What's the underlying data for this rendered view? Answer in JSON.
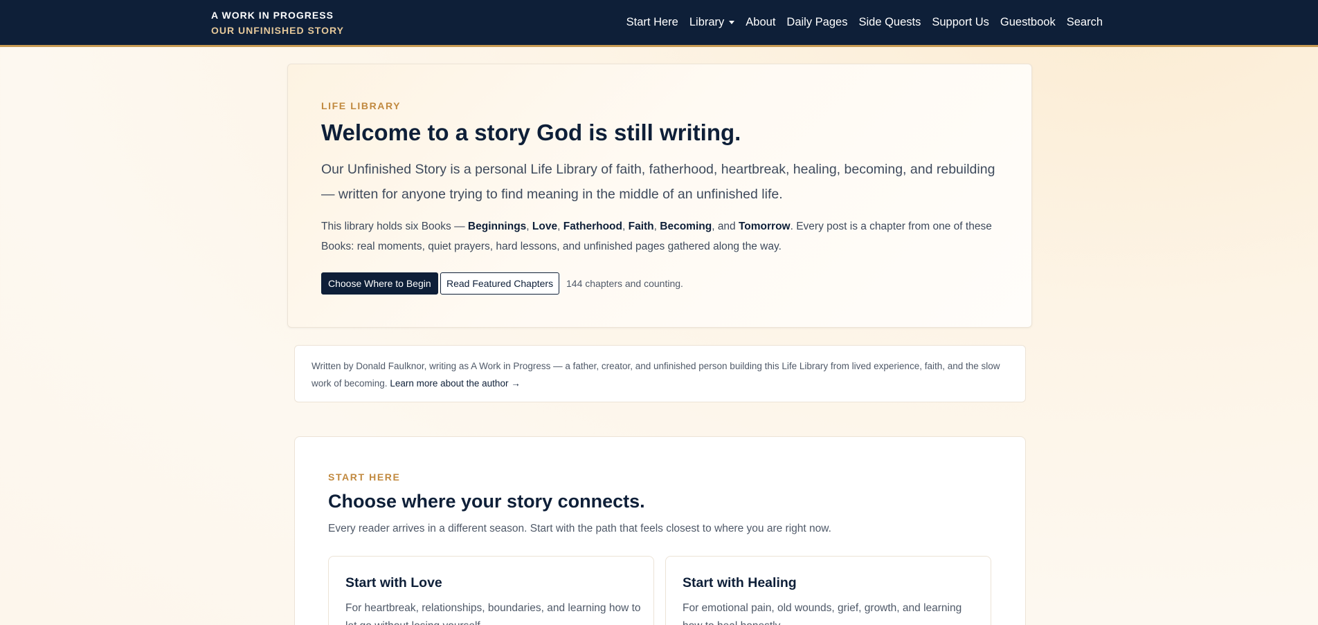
{
  "header": {
    "brand_title": "A WORK IN PROGRESS",
    "brand_subtitle": "OUR UNFINISHED STORY",
    "nav": [
      "Start Here",
      "Library",
      "About",
      "Daily Pages",
      "Side Quests",
      "Support Us",
      "Guestbook",
      "Search"
    ]
  },
  "hero": {
    "eyebrow": "LIFE LIBRARY",
    "title": "Welcome to a story God is still writing.",
    "lead": "Our Unfinished Story is a personal Life Library of faith, fatherhood, heartbreak, healing, becoming, and rebuilding — written for anyone trying to find meaning in the middle of an unfinished life.",
    "body": {
      "prefix": "This library holds six Books — ",
      "books": [
        "Beginnings",
        "Love",
        "Fatherhood",
        "Faith",
        "Becoming",
        "Tomorrow"
      ],
      "sep": ", ",
      "and": ", and ",
      "suffix": ". Every post is a chapter from one of these Books: real moments, quiet prayers, hard lessons, and unfinished pages gathered along the way."
    },
    "primary_button": "Choose Where to Begin",
    "secondary_button": "Read Featured Chapters",
    "count_text": "144 chapters and counting."
  },
  "author": {
    "text": "Written by Donald Faulknor, writing as A Work in Progress — a father, creator, and unfinished person building this Life Library from lived experience, faith, and the slow work of becoming.",
    "link": "Learn more about the author →"
  },
  "start_here": {
    "eyebrow": "START HERE",
    "title": "Choose where your story connects.",
    "intro": "Every reader arrives in a different season. Start with the path that feels closest to where you are right now.",
    "cards": [
      {
        "title": "Start with Love",
        "text": "For heartbreak, relationships, boundaries, and learning how to let go without losing yourself."
      },
      {
        "title": "Start with Healing",
        "text": "For emotional pain, old wounds, grief, growth, and learning how to heal honestly."
      }
    ]
  },
  "colors": {
    "navy": "#0e1f38",
    "gold": "#c1893f",
    "nav_border": "#c79a52"
  }
}
